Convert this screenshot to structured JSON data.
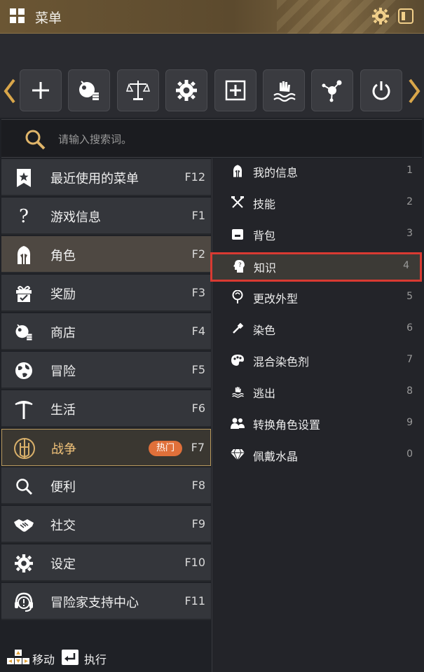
{
  "header": {
    "title": "菜单",
    "icons": [
      "grid-icon",
      "gear-icon",
      "panel-toggle-icon"
    ]
  },
  "toolbar": {
    "buttons": [
      {
        "name": "add-icon"
      },
      {
        "name": "shop-icon"
      },
      {
        "name": "scale-icon"
      },
      {
        "name": "gear-icon"
      },
      {
        "name": "inventory-add-icon"
      },
      {
        "name": "hand-water-icon"
      },
      {
        "name": "network-node-icon"
      },
      {
        "name": "power-icon"
      }
    ]
  },
  "search": {
    "placeholder": "请输入搜索词。"
  },
  "menu": {
    "items": [
      {
        "label": "最近使用的菜单",
        "key": "F12",
        "icon": "bookmark-star-icon"
      },
      {
        "label": "游戏信息",
        "key": "F1",
        "icon": "question-icon"
      },
      {
        "label": "角色",
        "key": "F2",
        "icon": "helmet-icon"
      },
      {
        "label": "奖励",
        "key": "F3",
        "icon": "gift-icon"
      },
      {
        "label": "商店",
        "key": "F4",
        "icon": "shop-icon"
      },
      {
        "label": "冒险",
        "key": "F5",
        "icon": "globe-icon"
      },
      {
        "label": "生活",
        "key": "F6",
        "icon": "pickaxe-icon"
      },
      {
        "label": "战争",
        "key": "F7",
        "icon": "war-shield-icon",
        "badge": "热门"
      },
      {
        "label": "便利",
        "key": "F8",
        "icon": "search-icon"
      },
      {
        "label": "社交",
        "key": "F9",
        "icon": "handshake-icon"
      },
      {
        "label": "设定",
        "key": "F10",
        "icon": "gear-icon"
      },
      {
        "label": "冒险家支持中心",
        "key": "F11",
        "icon": "headset-icon"
      }
    ]
  },
  "submenu": {
    "items": [
      {
        "label": "我的信息",
        "num": "1",
        "icon": "helmet-icon"
      },
      {
        "label": "技能",
        "num": "2",
        "icon": "crossed-tools-icon"
      },
      {
        "label": "背包",
        "num": "3",
        "icon": "bag-icon"
      },
      {
        "label": "知识",
        "num": "4",
        "icon": "head-knowledge-icon"
      },
      {
        "label": "更改外型",
        "num": "5",
        "icon": "mirror-icon"
      },
      {
        "label": "染色",
        "num": "6",
        "icon": "brush-icon"
      },
      {
        "label": "混合染色剂",
        "num": "7",
        "icon": "palette-icon"
      },
      {
        "label": "逃出",
        "num": "8",
        "icon": "escape-icon"
      },
      {
        "label": "转换角色设置",
        "num": "9",
        "icon": "swap-character-icon"
      },
      {
        "label": "佩戴水晶",
        "num": "0",
        "icon": "crystal-icon"
      }
    ]
  },
  "footer": {
    "move_label": "移动",
    "execute_label": "执行"
  },
  "colors": {
    "accent": "#f0c27a",
    "badge": "#e0703a",
    "highlight_border": "#d93a32",
    "header": "#6b5634"
  }
}
